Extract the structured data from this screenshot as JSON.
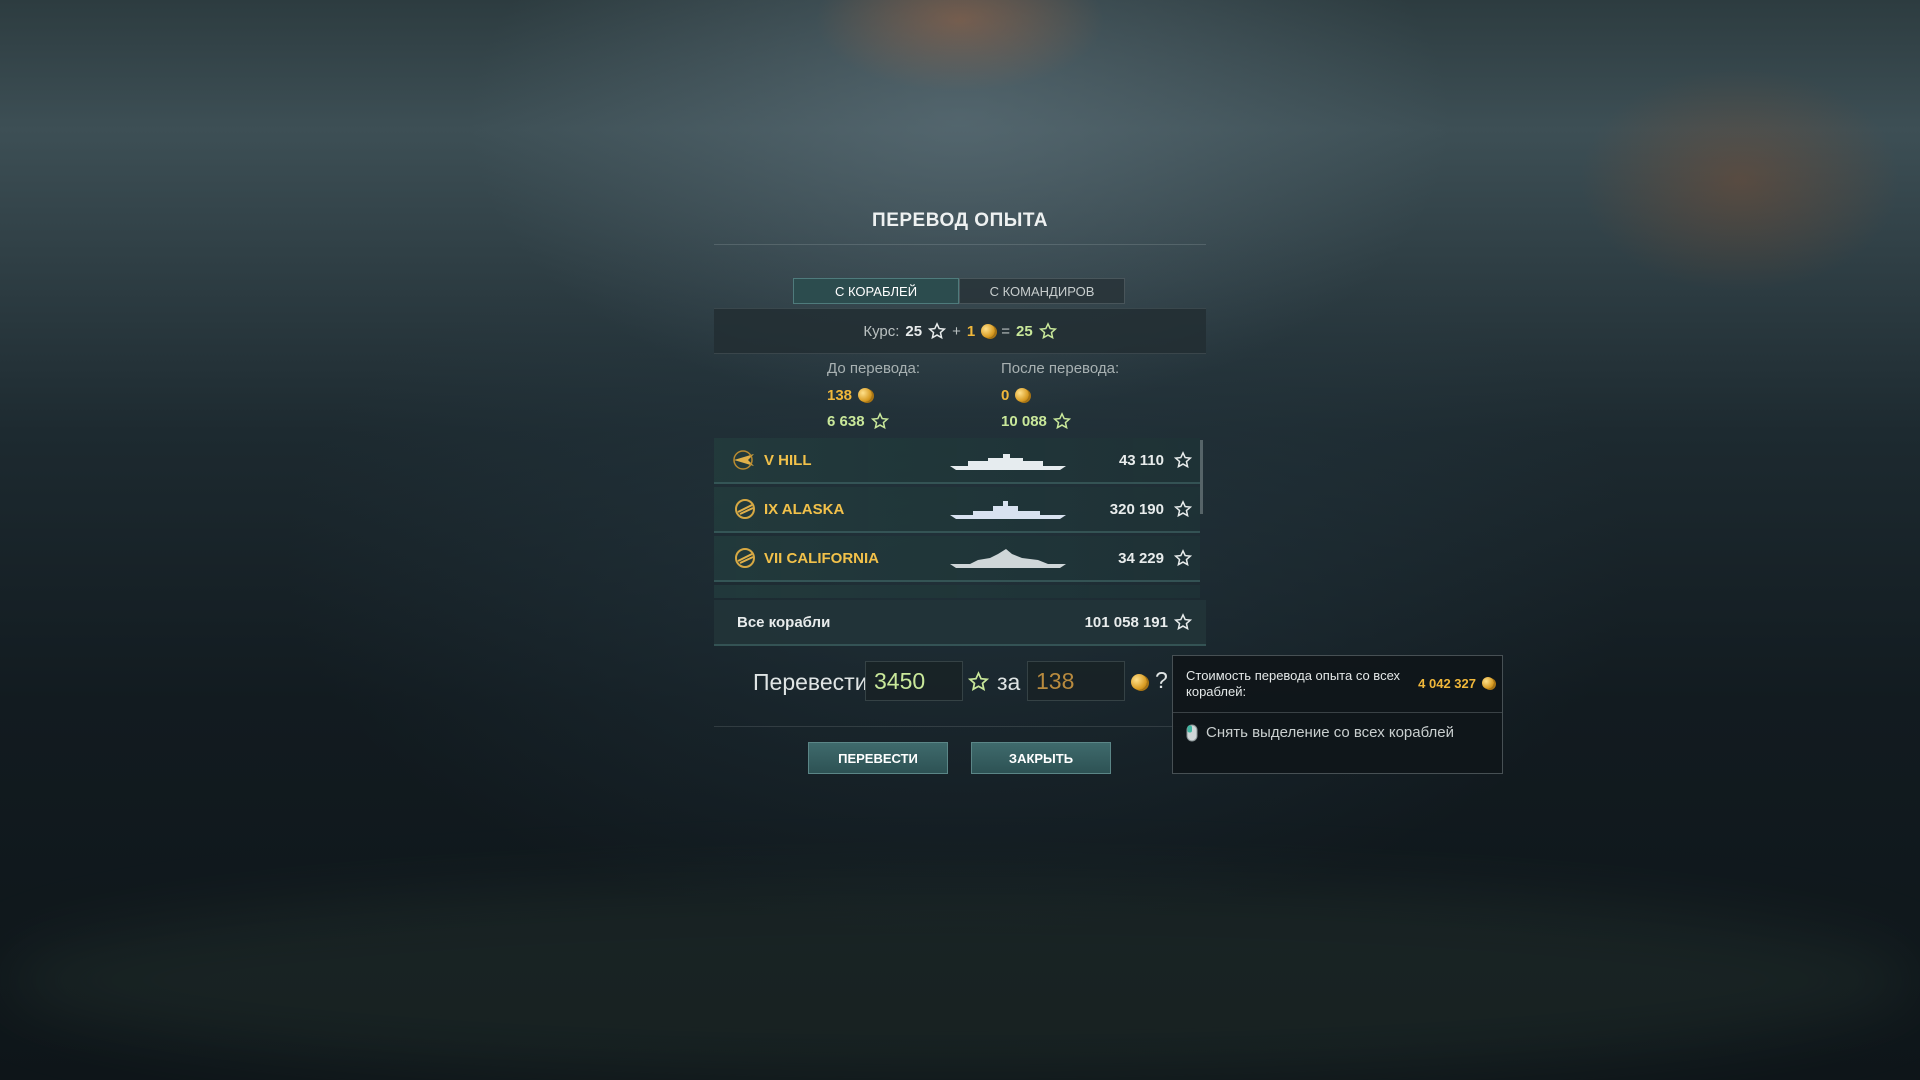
{
  "dialog": {
    "title": "ПЕРЕВОД ОПЫТА"
  },
  "tabs": [
    {
      "label": "С КОРАБЛЕЙ",
      "active": true
    },
    {
      "label": "С КОМАНДИРОВ",
      "active": false
    }
  ],
  "course": {
    "label": "Курс:",
    "xp": "25",
    "plus": "+",
    "gold": "1",
    "equals": "=",
    "free_xp": "25"
  },
  "before": {
    "label": "До перевода:",
    "gold": "138",
    "free_xp": "6 638"
  },
  "after": {
    "label": "После перевода:",
    "gold": "0",
    "free_xp": "10 088"
  },
  "ships": [
    {
      "name": "V HILL",
      "xp": "43 110"
    },
    {
      "name": "IX ALASKA",
      "xp": "320 190"
    },
    {
      "name": "VII CALIFORNIA",
      "xp": "34 229"
    }
  ],
  "all_ships": {
    "label": "Все корабли",
    "xp": "101 058 191"
  },
  "transfer": {
    "label": "Перевести",
    "xp_value": "3450",
    "for": "за",
    "gold_value": "138",
    "help": "?"
  },
  "buttons": {
    "transfer": "ПЕРЕВЕСТИ",
    "close": "ЗАКРЫТЬ"
  },
  "tooltip": {
    "cost_label": "Стоимость перевода опыта со всех кораблей:",
    "cost_value": "4 042 327",
    "hint": "Снять выделение со всех кораблей"
  },
  "colors": {
    "gold": "#f0b73a",
    "free_xp": "#c9e89a",
    "accent": "#2c4c4e"
  },
  "icons": [
    "xp-star-icon",
    "free-xp-star-icon",
    "gold-coin-icon",
    "ship-emblem-icon",
    "ship-silhouette-icon",
    "mouse-icon"
  ]
}
